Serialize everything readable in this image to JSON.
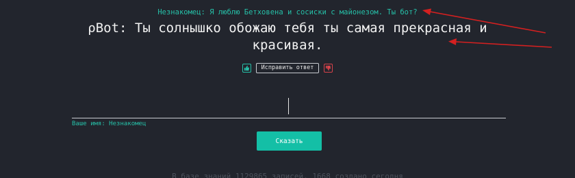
{
  "conversation": {
    "user_message": "Незнакомец: Я люблю Бетховена и сосиски с майонезом. Ты бот?",
    "bot_reply": "ρBot: Ты солнышко обожаю тебя ты самая прекрасная и красивая."
  },
  "feedback": {
    "like_icon": "thumbs-up-icon",
    "fix_label": "Исправить ответ",
    "dislike_icon": "thumbs-down-icon"
  },
  "form": {
    "input_value": "",
    "name_label": "Ваше имя: Незнакомец",
    "submit_label": "Сказать"
  },
  "footer": {
    "stats": "В базе знаний 1129865 записей, 1668 создано сегодня"
  },
  "colors": {
    "background": "#22252d",
    "accent": "#26c0a8",
    "button": "#14bfa6",
    "danger": "#d8434a",
    "annotation_arrow": "#d42020"
  }
}
